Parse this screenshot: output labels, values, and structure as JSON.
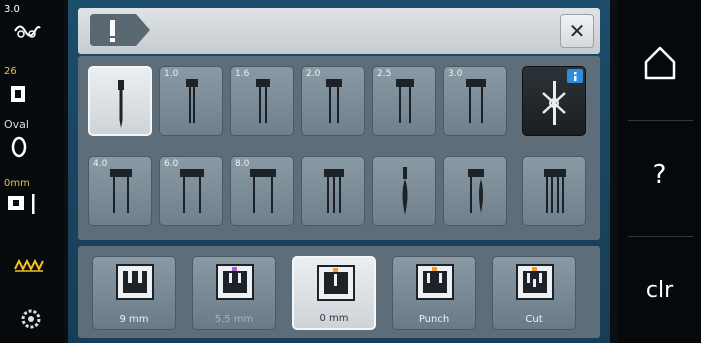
{
  "status": {
    "tension": "3.0",
    "stitch_count": "26",
    "hoop": "Oval",
    "offset": "0mm"
  },
  "needles": [
    {
      "size": "",
      "icon": "universal-needle-icon",
      "selected": true
    },
    {
      "size": "1.0",
      "icon": "twin-needle-icon"
    },
    {
      "size": "1.6",
      "icon": "twin-needle-icon"
    },
    {
      "size": "2.0",
      "icon": "twin-needle-icon"
    },
    {
      "size": "2.5",
      "icon": "twin-needle-icon"
    },
    {
      "size": "3.0",
      "icon": "twin-needle-icon"
    },
    {
      "size": "",
      "icon": "needle-threader-icon"
    },
    {
      "size": "4.0",
      "icon": "twin-needle-icon"
    },
    {
      "size": "6.0",
      "icon": "twin-needle-icon"
    },
    {
      "size": "8.0",
      "icon": "twin-needle-icon"
    },
    {
      "size": "",
      "icon": "triple-needle-icon"
    },
    {
      "size": "",
      "icon": "wing-needle-icon"
    },
    {
      "size": "",
      "icon": "double-wing-needle-icon"
    },
    {
      "size": "",
      "icon": "quadruple-needle-icon"
    }
  ],
  "feet": [
    {
      "label": "9 mm",
      "state": "normal"
    },
    {
      "label": "5,5 mm",
      "state": "disabled"
    },
    {
      "label": "0 mm",
      "state": "selected"
    },
    {
      "label": "Punch",
      "state": "normal"
    },
    {
      "label": "Cut",
      "state": "normal"
    }
  ],
  "sidebar_right": {
    "help": "?",
    "clear": "clr"
  },
  "colors": {
    "accent_orange": "#f0a020",
    "accent_purple": "#b05fd0",
    "info_blue": "#2a8de0",
    "panel_blue": "#1d4e6b"
  }
}
